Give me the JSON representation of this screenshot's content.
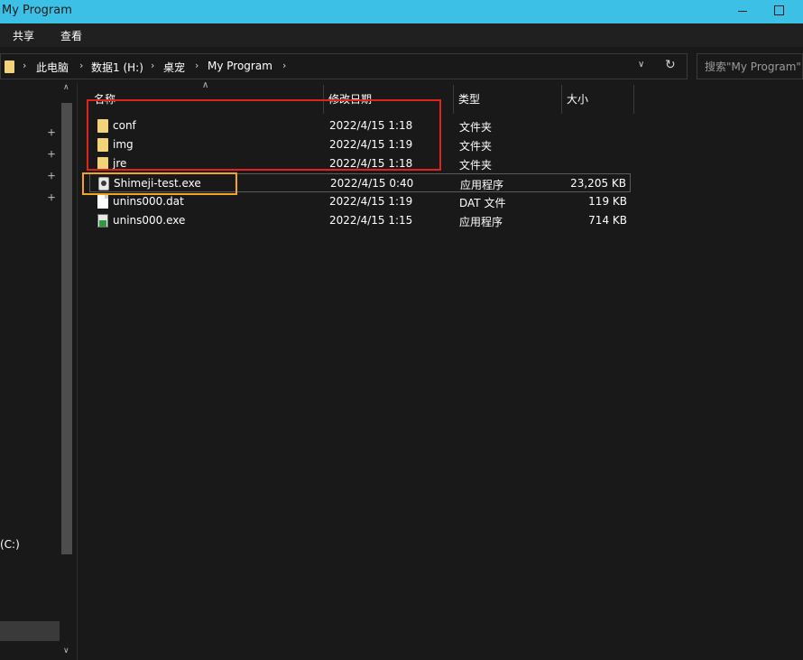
{
  "window": {
    "title": "My Program"
  },
  "ribbon": {
    "tabs": [
      "共享",
      "查看"
    ]
  },
  "address": {
    "crumbs": [
      "此电脑",
      "数据1 (H:)",
      "桌宠",
      "My Program"
    ],
    "separator": "›"
  },
  "search": {
    "placeholder": "搜索\"My Program\""
  },
  "nav": {
    "drive_label": "(C:)"
  },
  "columns": {
    "name": "名称",
    "date": "修改日期",
    "type": "类型",
    "size": "大小"
  },
  "files": [
    {
      "name": "conf",
      "date": "2022/4/15 1:18",
      "type": "文件夹",
      "size": "",
      "icon": "folder-icon"
    },
    {
      "name": "img",
      "date": "2022/4/15 1:19",
      "type": "文件夹",
      "size": "",
      "icon": "folder-icon"
    },
    {
      "name": "jre",
      "date": "2022/4/15 1:18",
      "type": "文件夹",
      "size": "",
      "icon": "folder-icon"
    },
    {
      "name": "Shimeji-test.exe",
      "date": "2022/4/15 0:40",
      "type": "应用程序",
      "size": "23,205 KB",
      "icon": "application-icon"
    },
    {
      "name": "unins000.dat",
      "date": "2022/4/15 1:19",
      "type": "DAT 文件",
      "size": "119 KB",
      "icon": "file-icon"
    },
    {
      "name": "unins000.exe",
      "date": "2022/4/15 1:15",
      "type": "应用程序",
      "size": "714 KB",
      "icon": "setup-icon"
    }
  ],
  "colors": {
    "titlebar": "#3cc0e6",
    "background": "#191919",
    "annotation_red": "#e0231c",
    "annotation_orange": "#f3a51d"
  }
}
